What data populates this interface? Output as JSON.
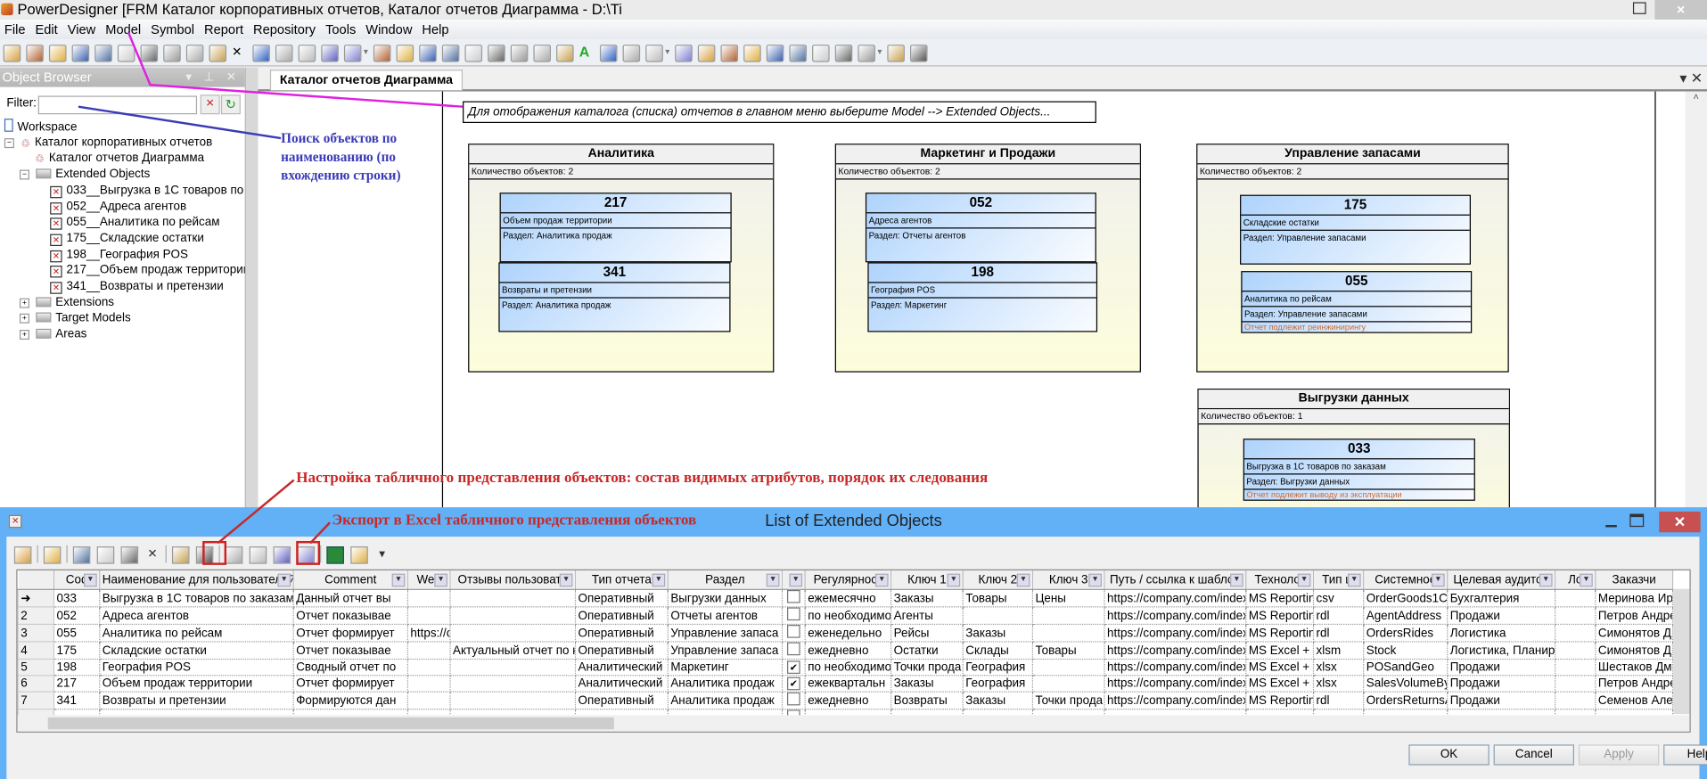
{
  "window": {
    "title": "PowerDesigner [FRM Каталог корпоративных отчетов, Каталог отчетов Диаграмма - D:\\Ti",
    "close": "×"
  },
  "menu": [
    "File",
    "Edit",
    "View",
    "Model",
    "Symbol",
    "Report",
    "Repository",
    "Tools",
    "Window",
    "Help"
  ],
  "toolbar_icons": [
    "new-icon",
    "open-project-icon",
    "open-icon",
    "save-icon",
    "save-all-icon",
    "print-preview-icon",
    "print-icon",
    "cut-icon",
    "copy-icon",
    "paste-icon",
    "delete-icon",
    "undo-icon",
    "redo-icon",
    "properties-icon",
    "check-model-icon",
    "repository-icon",
    "|",
    "new-diagram-icon",
    "paste-as-shortcut-icon",
    "find-icon",
    "refresh-icon",
    "check-icon",
    "shadow-icon",
    "group-icon",
    "brush-icon",
    "fill-icon",
    "text-icon",
    "export-icon",
    "back-icon",
    "forward-icon",
    "|",
    "diagram-view-icon",
    "diagram-2-icon",
    "page-icon",
    "pages-icon",
    "diagram-green-icon",
    "diagram-gray-icon",
    "zoom-diagram-icon",
    "text-view-icon",
    "grid-view-icon",
    "|",
    "preview-icon",
    "print-2-icon"
  ],
  "object_browser": {
    "title": "Object Browser",
    "controls": "▾ ⊥ ✕",
    "filter_label": "Filter:",
    "filter_value": "",
    "tree": [
      {
        "label": "Workspace",
        "icon": "ws",
        "level": 0
      },
      {
        "label": "Каталог корпоративных отчетов",
        "icon": "model",
        "level": 0,
        "exp": "−"
      },
      {
        "label": "Каталог отчетов Диаграмма",
        "icon": "model",
        "level": 1
      },
      {
        "label": "Extended Objects",
        "icon": "folder",
        "level": 1,
        "exp": "−"
      },
      {
        "label": "033__Выгрузка в 1С товаров по заказам",
        "icon": "x",
        "level": 2
      },
      {
        "label": "052__Адреса агентов",
        "icon": "x",
        "level": 2
      },
      {
        "label": "055__Аналитика по рейсам",
        "icon": "x",
        "level": 2
      },
      {
        "label": "175__Складские остатки",
        "icon": "x",
        "level": 2
      },
      {
        "label": "198__География POS",
        "icon": "x",
        "level": 2
      },
      {
        "label": "217__Объем продаж территории",
        "icon": "x",
        "level": 2
      },
      {
        "label": "341__Возвраты и претензии",
        "icon": "x",
        "level": 2
      },
      {
        "label": "Extensions",
        "icon": "folder",
        "level": 1,
        "exp": "+"
      },
      {
        "label": "Target Models",
        "icon": "folder",
        "level": 1,
        "exp": "+"
      },
      {
        "label": "Areas",
        "icon": "folder",
        "level": 1,
        "exp": "+"
      }
    ]
  },
  "diagram": {
    "tab": "Каталог отчетов Диаграмма",
    "tab_controls": "▾ ✕",
    "note": "Для отображения каталога (списка) отчетов в главном меню выберите Model --> Extended Objects...",
    "groups": [
      {
        "title": "Аналитика",
        "count": "Количество объектов: 2",
        "objects": [
          {
            "code": "217",
            "name": "Объем продаж территории",
            "section": "Раздел:  Аналитика продаж",
            "warn": ""
          },
          {
            "code": "341",
            "name": "Возвраты и претензии",
            "section": "Раздел:  Аналитика продаж",
            "warn": ""
          }
        ]
      },
      {
        "title": "Маркетинг и Продажи",
        "count": "Количество объектов: 2",
        "objects": [
          {
            "code": "052",
            "name": "Адреса агентов",
            "section": "Раздел:  Отчеты агентов",
            "warn": ""
          },
          {
            "code": "198",
            "name": "География POS",
            "section": "Раздел:  Маркетинг",
            "warn": ""
          }
        ]
      },
      {
        "title": "Управление запасами",
        "count": "Количество объектов: 2",
        "objects": [
          {
            "code": "175",
            "name": "Складские остатки",
            "section": "Раздел:  Управление запасами",
            "warn": ""
          },
          {
            "code": "055",
            "name": "Аналитика по рейсам",
            "section": "Раздел:  Управление запасами",
            "warn": "Отчет подлежит реинжинирингу"
          }
        ]
      },
      {
        "title": "Выгрузки данных",
        "count": "Количество объектов: 1",
        "objects": [
          {
            "code": "033",
            "name": "Выгрузка в 1С товаров по заказам",
            "section": "Раздел:  Выгрузки данных",
            "warn": "Отчет подлежит выводу из эксплуатации"
          }
        ]
      }
    ]
  },
  "annotations": {
    "search": "Поиск объектов по наименованию (по вхождению строки)",
    "customize": "Настройка табличного представления объектов: состав видимых атрибутов, порядок их следования",
    "export": "Экспорт в Excel табличного представления объектов",
    "colors": {
      "magenta": "#e020e0",
      "blue": "#3b3bb8",
      "red": "#c82828"
    }
  },
  "dialog": {
    "title": "List of Extended Objects",
    "toolbar_icons": [
      "properties-icon",
      "|",
      "add-rows-icon",
      "|",
      "cut-icon",
      "copy-icon",
      "paste-icon",
      "delete-icon",
      "|",
      "find-icon",
      "find-in-diagram-icon",
      "|",
      "customize-columns-filter-icon",
      "filter-icon",
      "check-in-icon",
      "shortcut-icon",
      "|",
      "export-excel-icon",
      "print-icon",
      "dropdown-icon"
    ],
    "columns": [
      "Cod",
      "Наименование для пользователей",
      "Comment",
      "Web",
      "Отзывы пользовате",
      "Тип отчета",
      "Раздел",
      "О",
      "Регулярност",
      "Ключ 1",
      "Ключ 2",
      "Ключ 3",
      "Путь / ссылка к шаблон",
      "Технолог",
      "Тип ш",
      "Системное",
      "Целевая аудитор",
      "Ло",
      "Заказчи"
    ],
    "rows": [
      {
        "rh": "➜",
        "cells": [
          "033",
          "Выгрузка в 1С товаров по заказам",
          "Данный отчет вы",
          "",
          "",
          "Оперативный",
          "Выгрузки данных",
          false,
          "ежемесячно",
          "Заказы",
          "Товары",
          "Цены",
          "https://company.com/index.",
          "MS Reportin",
          "csv",
          "OrderGoods1C_",
          "Бухгалтерия",
          "",
          "Меринова Ир"
        ]
      },
      {
        "rh": "2",
        "cells": [
          "052",
          "Адреса агентов",
          "Отчет показывае",
          "",
          "",
          "Оперативный",
          "Отчеты агентов",
          false,
          "по необходимо",
          "Агенты",
          "",
          "",
          "https://company.com/index.",
          "MS Reportin",
          "rdl",
          "AgentAddress",
          "Продажи",
          "",
          "Петров Андре"
        ]
      },
      {
        "rh": "3",
        "cells": [
          "055",
          "Аналитика по рейсам",
          "Отчет формирует",
          "https://c",
          "",
          "Оперативный",
          "Управление запаса",
          false,
          "еженедельно",
          "Рейсы",
          "Заказы",
          "",
          "https://company.com/index.",
          "MS Reportin",
          "rdl",
          "OrdersRides",
          "Логистика",
          "",
          "Симонятов Д"
        ]
      },
      {
        "rh": "4",
        "cells": [
          "175",
          "Складские остатки",
          "Отчет показывае",
          "",
          "Актуальный отчет по к",
          "Оперативный",
          "Управление запаса",
          false,
          "ежедневно",
          "Остатки",
          "Склады",
          "Товары",
          "https://company.com/index.",
          "MS Excel +",
          "xlsm",
          "Stock",
          "Логистика, Планиро",
          "",
          "Симонятов Д"
        ]
      },
      {
        "rh": "5",
        "cells": [
          "198",
          "География POS",
          "Сводный отчет по",
          "",
          "",
          "Аналитический",
          "Маркетинг",
          true,
          "по необходимо",
          "Точки прода",
          "География",
          "",
          "https://company.com/index.",
          "MS Excel +",
          "xlsx",
          "POSandGeo",
          "Продажи",
          "",
          "Шестаков Дм"
        ]
      },
      {
        "rh": "6",
        "cells": [
          "217",
          "Объем продаж территории",
          "Отчет формирует",
          "",
          "",
          "Аналитический",
          "Аналитика продаж",
          true,
          "ежеквартальн",
          "Заказы",
          "География",
          "",
          "https://company.com/index.",
          "MS Excel +",
          "xlsx",
          "SalesVolumeBy",
          "Продажи",
          "",
          "Петров Андре"
        ]
      },
      {
        "rh": "7",
        "cells": [
          "341",
          "Возвраты и претензии",
          "Формируются дан",
          "",
          "",
          "Оперативный",
          "Аналитика продаж",
          false,
          "ежедневно",
          "Возвраты",
          "Заказы",
          "Точки прода",
          "https://company.com/index.",
          "MS Reportin",
          "rdl",
          "OrdersReturnsA",
          "Продажи",
          "",
          "Семенов Алек"
        ]
      },
      {
        "rh": "",
        "cells": [
          "",
          "",
          "",
          "",
          "",
          "",
          "",
          false,
          "",
          "",
          "",
          "",
          "",
          "",
          "",
          "",
          "",
          "",
          ""
        ]
      }
    ],
    "buttons": {
      "ok": "OK",
      "cancel": "Cancel",
      "apply": "Apply",
      "help": "Help"
    }
  }
}
